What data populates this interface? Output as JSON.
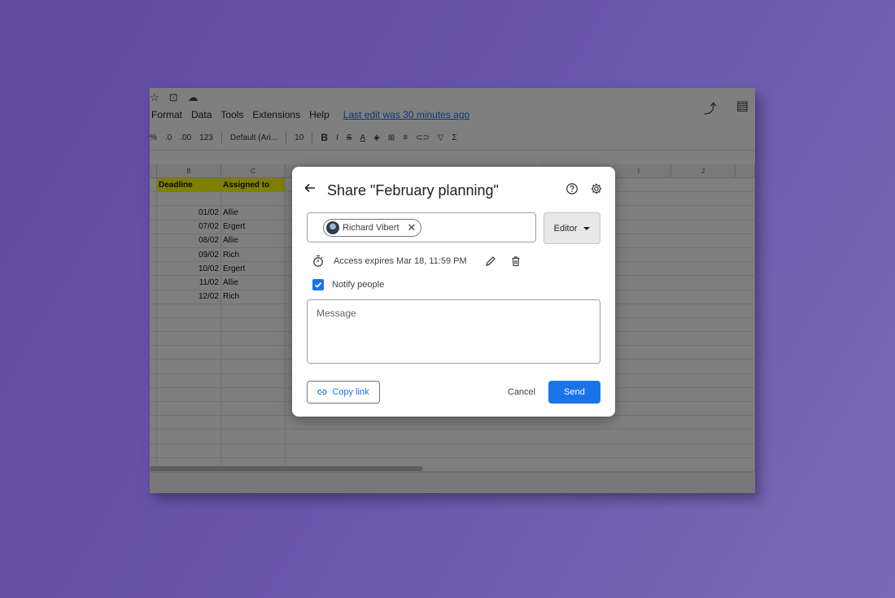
{
  "menu": {
    "items": [
      "Format",
      "Data",
      "Tools",
      "Extensions",
      "Help"
    ],
    "last_edit": "Last edit was 30 minutes ago"
  },
  "toolbar": {
    "format_items": [
      "%",
      ".0",
      ".00",
      "123"
    ],
    "font": "Default (Ari...",
    "font_size": "10"
  },
  "sheet": {
    "column_headers": [
      "B",
      "C",
      "I",
      "J"
    ],
    "header_row": {
      "deadline": "Deadline",
      "assigned_to": "Assigned to"
    },
    "rows": [
      {
        "deadline": "01/02",
        "assignee": "Allie"
      },
      {
        "deadline": "07/02",
        "assignee": "Ergert"
      },
      {
        "deadline": "08/02",
        "assignee": "Allie"
      },
      {
        "deadline": "09/02",
        "assignee": "Rich"
      },
      {
        "deadline": "10/02",
        "assignee": "Ergert"
      },
      {
        "deadline": "11/02",
        "assignee": "Allie"
      },
      {
        "deadline": "12/02",
        "assignee": "Rich"
      }
    ]
  },
  "dialog": {
    "title": "Share \"February planning\"",
    "person_chip": "Richard Vibert",
    "role": "Editor",
    "access_expires": "Access expires Mar 18, 11:59 PM",
    "notify_label": "Notify people",
    "notify_checked": true,
    "message_placeholder": "Message",
    "copy_link": "Copy link",
    "cancel": "Cancel",
    "send": "Send"
  },
  "colors": {
    "primary": "#1a73e8",
    "highlight": "#ffff00"
  }
}
